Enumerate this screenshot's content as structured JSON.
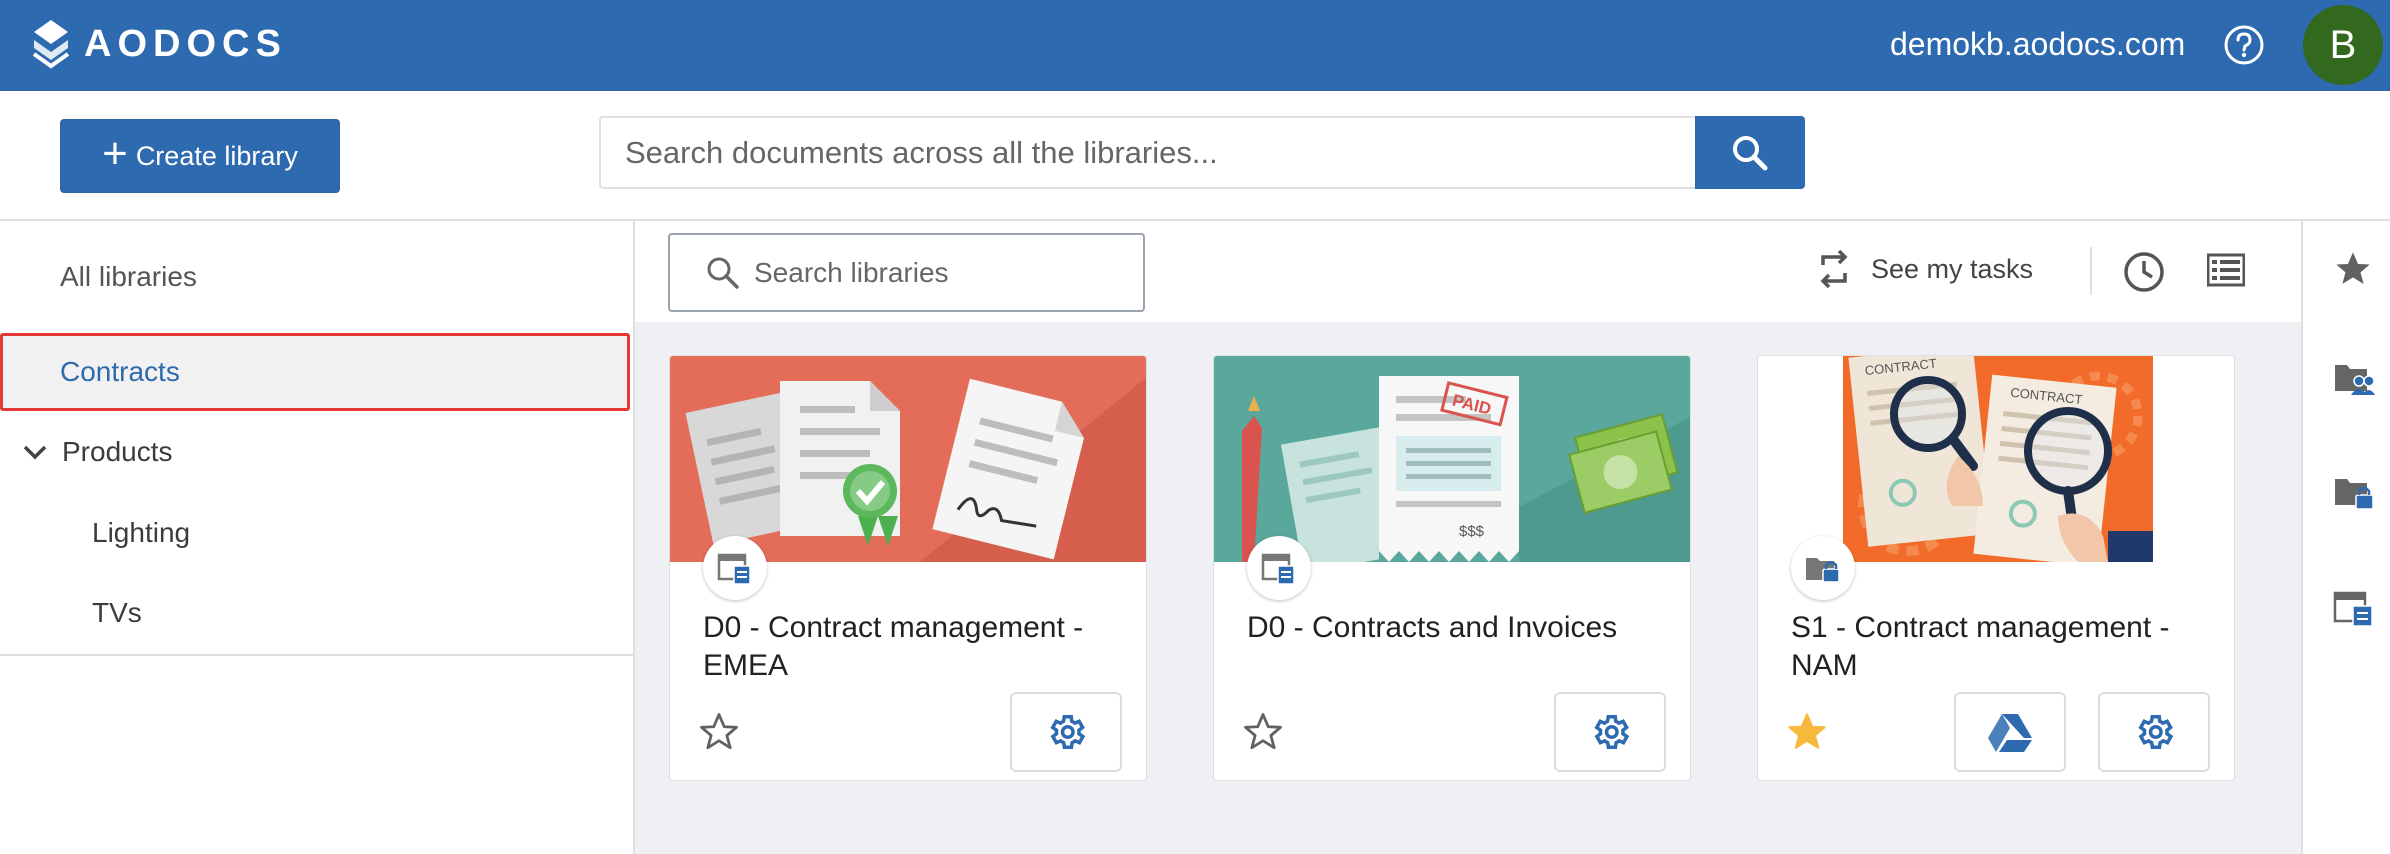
{
  "header": {
    "logo_text": "AODOCS",
    "domain": "demokb.aodocs.com",
    "help_icon": "help-circle-icon",
    "avatar_initial": "B",
    "avatar_color": "#33691e",
    "brand_color": "#2d6aaf"
  },
  "toolbar": {
    "create_label": "Create library",
    "search_placeholder": "Search documents across all the libraries..."
  },
  "sidebar": {
    "all_label": "All libraries",
    "items": [
      {
        "label": "Contracts",
        "selected": true
      },
      {
        "label": "Products",
        "expanded": true
      },
      {
        "label": "Lighting"
      },
      {
        "label": "TVs"
      }
    ]
  },
  "main": {
    "search_placeholder": "Search libraries",
    "tasks_label": "See my tasks",
    "cards": [
      {
        "title": "D0 - Contract management - EMEA",
        "starred": false,
        "type_icon": "document-library-icon"
      },
      {
        "title": "D0 - Contracts and Invoices",
        "starred": false,
        "type_icon": "document-library-icon"
      },
      {
        "title": "S1 - Contract management - NAM",
        "starred": true,
        "type_icon": "secured-folder-icon"
      }
    ],
    "image_text": {
      "paid_stamp": "PAID",
      "dollars": "$$$",
      "contract_label": "CONTRACT"
    }
  },
  "rail": {
    "icons": [
      "star-icon",
      "shared-folder-icon",
      "locked-folder-icon",
      "document-library-icon"
    ]
  }
}
